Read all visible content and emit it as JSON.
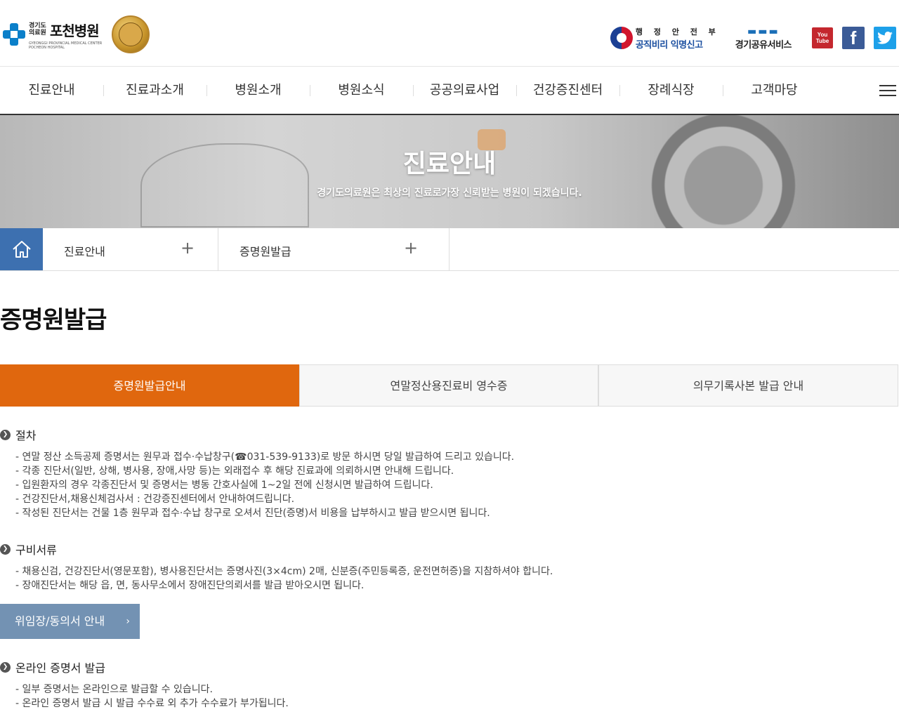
{
  "header": {
    "logo_small": "경기도\n의료원",
    "logo_name": "포천병원",
    "logo_english": "GYEONGGI PROVINCIAL MEDICAL CENTER POCHEON HOSPITAL",
    "gov_line1": "행 정 안 전 부",
    "gov_line2": "공직비리 익명신고",
    "share_label": "경기공유서비스",
    "sns": {
      "youtube": "You Tube",
      "facebook": "f",
      "twitter": "🐦"
    }
  },
  "nav": {
    "items": [
      "진료안내",
      "진료과소개",
      "병원소개",
      "병원소식",
      "공공의료사업",
      "건강증진센터",
      "장례식장",
      "고객마당"
    ]
  },
  "banner": {
    "title": "진료안내",
    "subtitle": "경기도의료원은 최상의 진료로가장 신뢰받는 병원이 되겠습니다."
  },
  "breadcrumb": {
    "level1": "진료안내",
    "level2": "증명원발급",
    "plus": "+"
  },
  "page_title": "증명원발급",
  "tabs": [
    "증명원발급안내",
    "연말정산용진료비 영수증",
    "의무기록사본 발급 안내"
  ],
  "sections": {
    "procedure": {
      "title": "절차",
      "items": [
        "- 연말 정산 소득공제 증명서는 원무과 접수·수납창구(☎031-539-9133)로 방문 하시면 당일 발급하여 드리고 있습니다.",
        "- 각종 진단서(일반, 상해, 병사용, 장애,사망 등)는 외래접수 후 해당 진료과에 의뢰하시면 안내해 드립니다.",
        "- 입원환자의 경우 각종진단서 및 증명서는 병동 간호사실에 1~2일 전에 신청시면 발급하여 드립니다.",
        "- 건강진단서,채용신체검사서 : 건강증진센터에서 안내하여드립니다.",
        "- 작성된 진단서는 건물 1층 원무과 접수·수납 창구로 오셔서 진단(증명)서 비용을 납부하시고 발급 받으시면 됩니다."
      ]
    },
    "documents": {
      "title": "구비서류",
      "items": [
        "- 채용신검, 건강진단서(영문포함), 병사용진단서는 증명사진(3×4cm) 2매, 신분증(주민등록증, 운전면허증)을 지참하셔야 합니다.",
        "- 장애진단서는 해당 읍, 면, 동사무소에서 장애진단의뢰서를 발급 받아오시면 됩니다."
      ]
    },
    "delegate_button": "위임장/동의서 안내",
    "online": {
      "title": "온라인 증명서 발급",
      "items": [
        "- 일부 증명서는 온라인으로 발급할 수 있습니다.",
        "- 온라인 증명서 발급 시 발급 수수료 외 추가 수수료가 부가됩니다."
      ]
    }
  },
  "colors": {
    "accent_orange": "#e0670e",
    "home_blue": "#3d70b0",
    "button_blue": "#7392b3"
  }
}
